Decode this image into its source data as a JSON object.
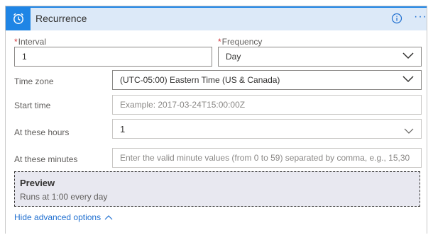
{
  "header": {
    "title": "Recurrence"
  },
  "fields": {
    "interval": {
      "label": "Interval",
      "value": "1",
      "required_mark": "*"
    },
    "frequency": {
      "label": "Frequency",
      "value": "Day",
      "required_mark": "*"
    },
    "time_zone": {
      "label": "Time zone",
      "value": "(UTC-05:00) Eastern Time (US & Canada)"
    },
    "start_time": {
      "label": "Start time",
      "placeholder": "Example: 2017-03-24T15:00:00Z"
    },
    "at_these_hours": {
      "label": "At these hours",
      "value": "1"
    },
    "at_these_minutes": {
      "label": "At these minutes",
      "placeholder": "Enter the valid minute values (from 0 to 59) separated by comma, e.g., 15,30"
    }
  },
  "preview": {
    "title": "Preview",
    "text": "Runs at 1:00 every day"
  },
  "footer": {
    "hide_advanced_label": "Hide advanced options"
  },
  "colors": {
    "accent": "#1f85e5",
    "header_bg": "#dce9f8",
    "link": "#1f6fd0",
    "required": "#d13438"
  },
  "icons": {
    "header": "alarm-clock-icon",
    "info": "info-icon",
    "more": "more-options-icon",
    "chevron": "chevron-down-icon",
    "chevron_up": "chevron-up-icon"
  }
}
